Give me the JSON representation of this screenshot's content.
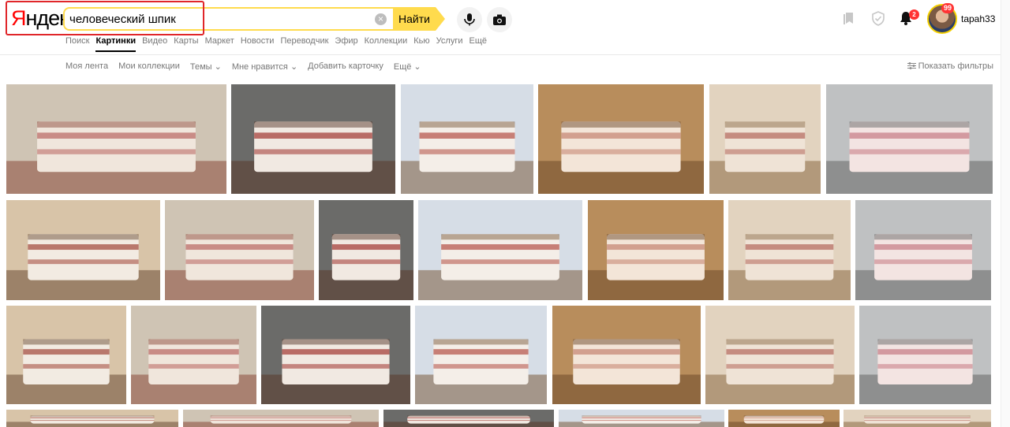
{
  "logo": {
    "text": "Яндекс"
  },
  "search": {
    "query": "человеческий шпик",
    "button": "Найти"
  },
  "tabs": [
    {
      "label": "Поиск",
      "active": false
    },
    {
      "label": "Картинки",
      "active": true
    },
    {
      "label": "Видео",
      "active": false
    },
    {
      "label": "Карты",
      "active": false
    },
    {
      "label": "Маркет",
      "active": false
    },
    {
      "label": "Новости",
      "active": false
    },
    {
      "label": "Переводчик",
      "active": false
    },
    {
      "label": "Эфир",
      "active": false
    },
    {
      "label": "Коллекции",
      "active": false
    },
    {
      "label": "Кью",
      "active": false
    },
    {
      "label": "Услуги",
      "active": false
    },
    {
      "label": "Ещё",
      "active": false
    }
  ],
  "user": {
    "name": "tapah33",
    "notifications": "2",
    "avatar_badge": "99"
  },
  "subnav": {
    "items": [
      "Моя лента",
      "Мои коллекции",
      "Темы ⌄",
      "Мне нравится ⌄",
      "Добавить карточку",
      "Ещё ⌄"
    ],
    "filters": "Показать фильтры"
  },
  "colors": {
    "accent": "#ffdb4d",
    "highlight": "#e0262a",
    "brand_red": "#ff0000"
  },
  "image_tiles": {
    "count": 27,
    "subject": "salo (pork fat) photos"
  }
}
